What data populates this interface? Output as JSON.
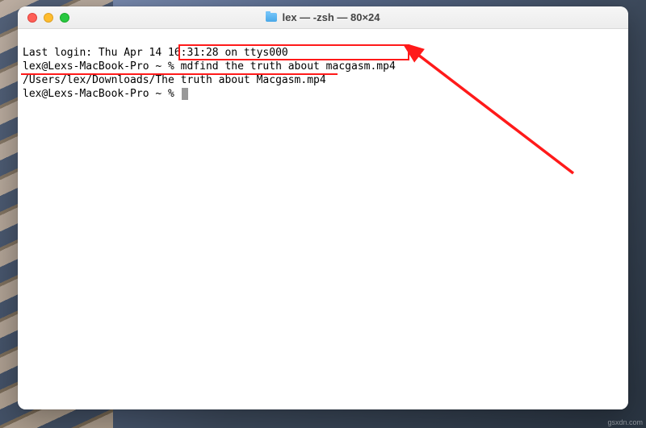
{
  "window": {
    "title": "lex — -zsh — 80×24"
  },
  "terminal": {
    "line1_prefix": "Last login: ",
    "line1_rest": "Thu Apr 14 16:31:28 on ttys000",
    "prompt": "lex@Lexs-MacBook-Pro ~ % ",
    "command": "mdfind the truth about macgasm.mp4",
    "result": "/Users/lex/Downloads/The truth about Macgasm.mp4"
  },
  "annotation": {
    "color": "#ff1a1a"
  },
  "watermark": "gsxdn.com"
}
